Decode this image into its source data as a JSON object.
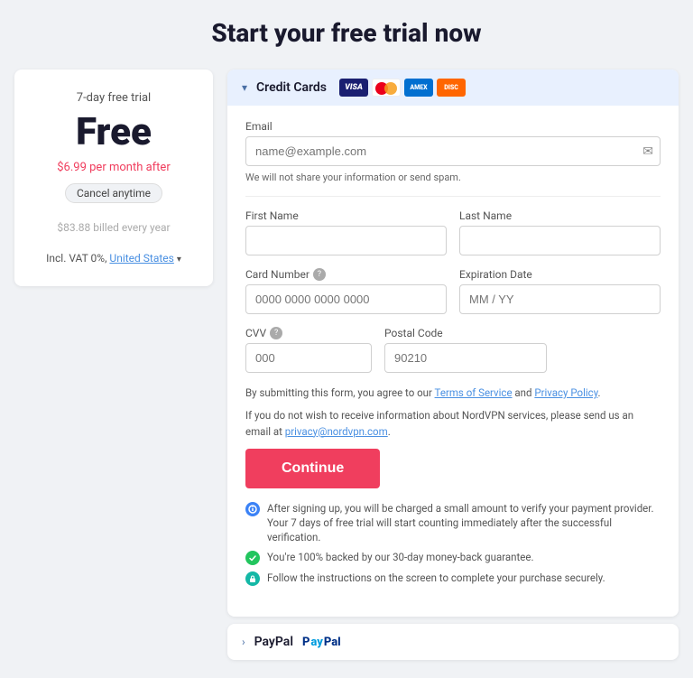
{
  "page": {
    "title": "Start your free trial now"
  },
  "left_panel": {
    "trial_label": "7-day free trial",
    "price": "Free",
    "per_month_text": "$6.99 per month after",
    "cancel_label": "Cancel anytime",
    "billed_info": "$83.88 billed every year",
    "vat_text": "Incl. VAT 0%,",
    "country": "United States"
  },
  "payment_section": {
    "chevron": "▾",
    "header_label": "Credit Cards",
    "cards": [
      "VISA",
      "MC",
      "AMEX",
      "DISCOVER"
    ]
  },
  "form": {
    "email_label": "Email",
    "email_placeholder": "name@example.com",
    "no_share_text": "We will not share your information or send spam.",
    "first_name_label": "First Name",
    "first_name_placeholder": "",
    "last_name_label": "Last Name",
    "last_name_placeholder": "",
    "card_number_label": "Card Number",
    "card_number_placeholder": "0000 0000 0000 0000",
    "expiry_label": "Expiration Date",
    "expiry_placeholder": "MM / YY",
    "cvv_label": "CVV",
    "cvv_placeholder": "000",
    "postal_label": "Postal Code",
    "postal_placeholder": "90210",
    "legal_line1_before": "By submitting this form, you agree to our ",
    "legal_tos": "Terms of Service",
    "legal_and": " and ",
    "legal_pp": "Privacy Policy",
    "legal_line1_after": ".",
    "legal_line2": "If you do not wish to receive information about NordVPN services, please send us an email at ",
    "legal_email": "privacy@nordvpn.com",
    "legal_line2_end": ".",
    "continue_label": "Continue"
  },
  "info_items": [
    {
      "icon_type": "blue",
      "text": "After signing up, you will be charged a small amount to verify your payment provider. Your 7 days of free trial will start counting immediately after the successful verification."
    },
    {
      "icon_type": "green",
      "text": "You're 100% backed by our 30-day money-back guarantee."
    },
    {
      "icon_type": "teal",
      "text": "Follow the instructions on the screen to complete your purchase securely."
    }
  ],
  "paypal_section": {
    "chevron": "›",
    "label": "PayPal",
    "logo_p": "P",
    "logo_paypal": "PayPal"
  }
}
